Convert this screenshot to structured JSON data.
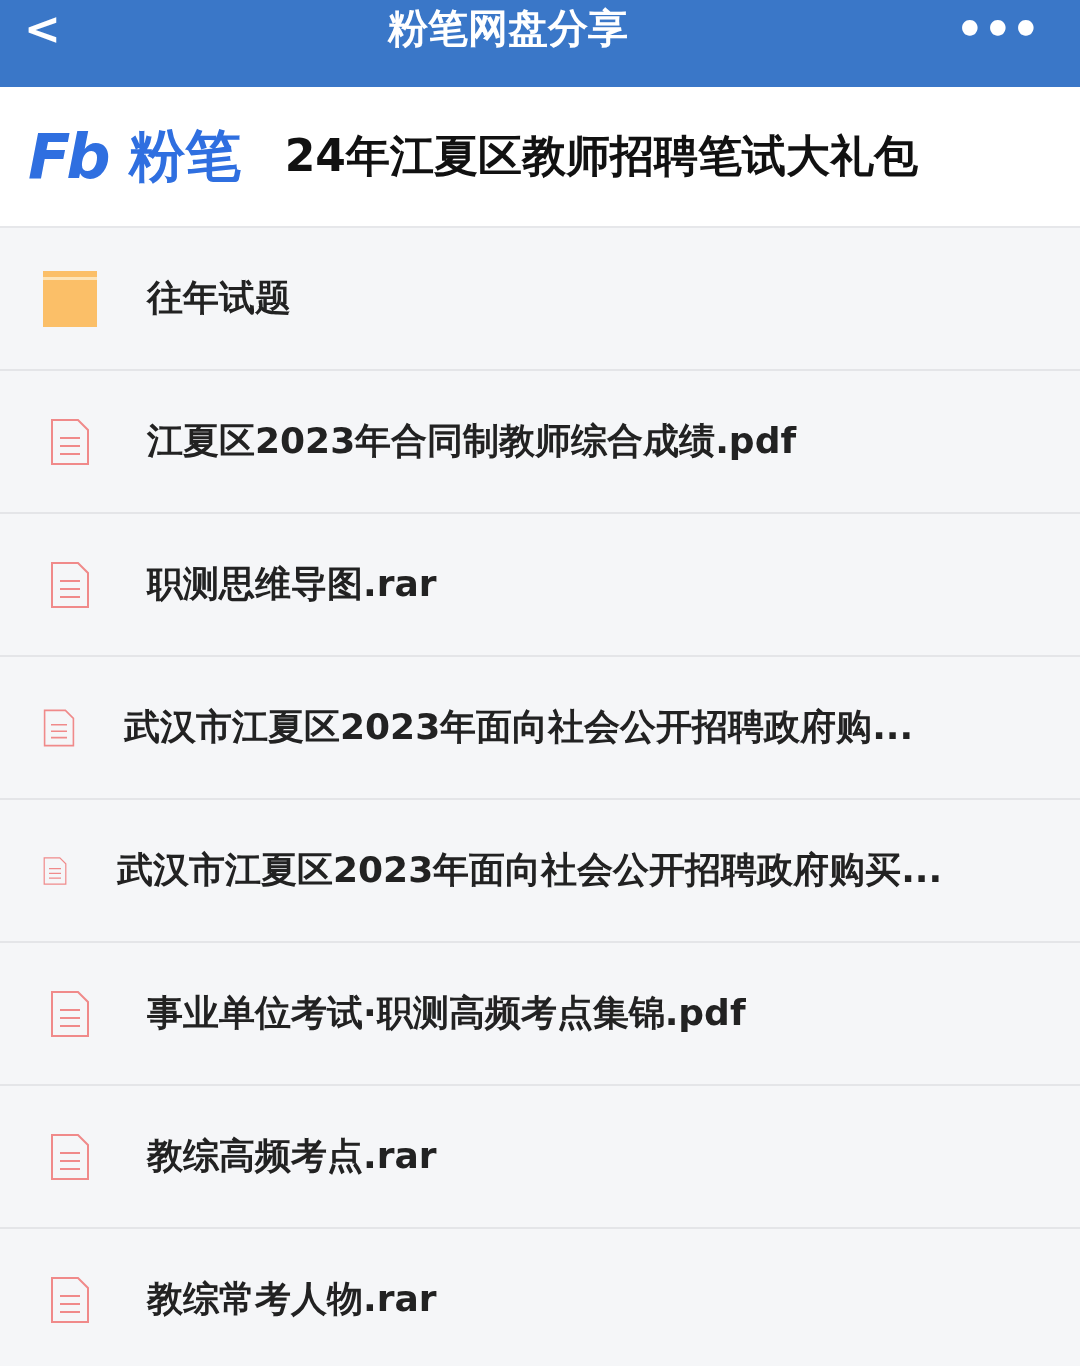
{
  "nav": {
    "back": "<",
    "title": "粉笔网盘分享",
    "more": "•••"
  },
  "banner": {
    "logo_mark": "Fb",
    "logo_text": "粉笔",
    "title": "24年江夏区教师招聘笔试大礼包"
  },
  "items": [
    {
      "kind": "folder",
      "name": "往年试题"
    },
    {
      "kind": "file",
      "name": "江夏区2023年合同制教师综合成绩.pdf"
    },
    {
      "kind": "file",
      "name": "职测思维导图.rar"
    },
    {
      "kind": "file-medium",
      "name": "武汉市江夏区2023年面向社会公开招聘政府购..."
    },
    {
      "kind": "file-small",
      "name": "武汉市江夏区2023年面向社会公开招聘政府购买..."
    },
    {
      "kind": "file",
      "name": "事业单位考试·职测高频考点集锦.pdf"
    },
    {
      "kind": "file",
      "name": "教综高频考点.rar"
    },
    {
      "kind": "file",
      "name": "教综常考人物.rar"
    }
  ]
}
